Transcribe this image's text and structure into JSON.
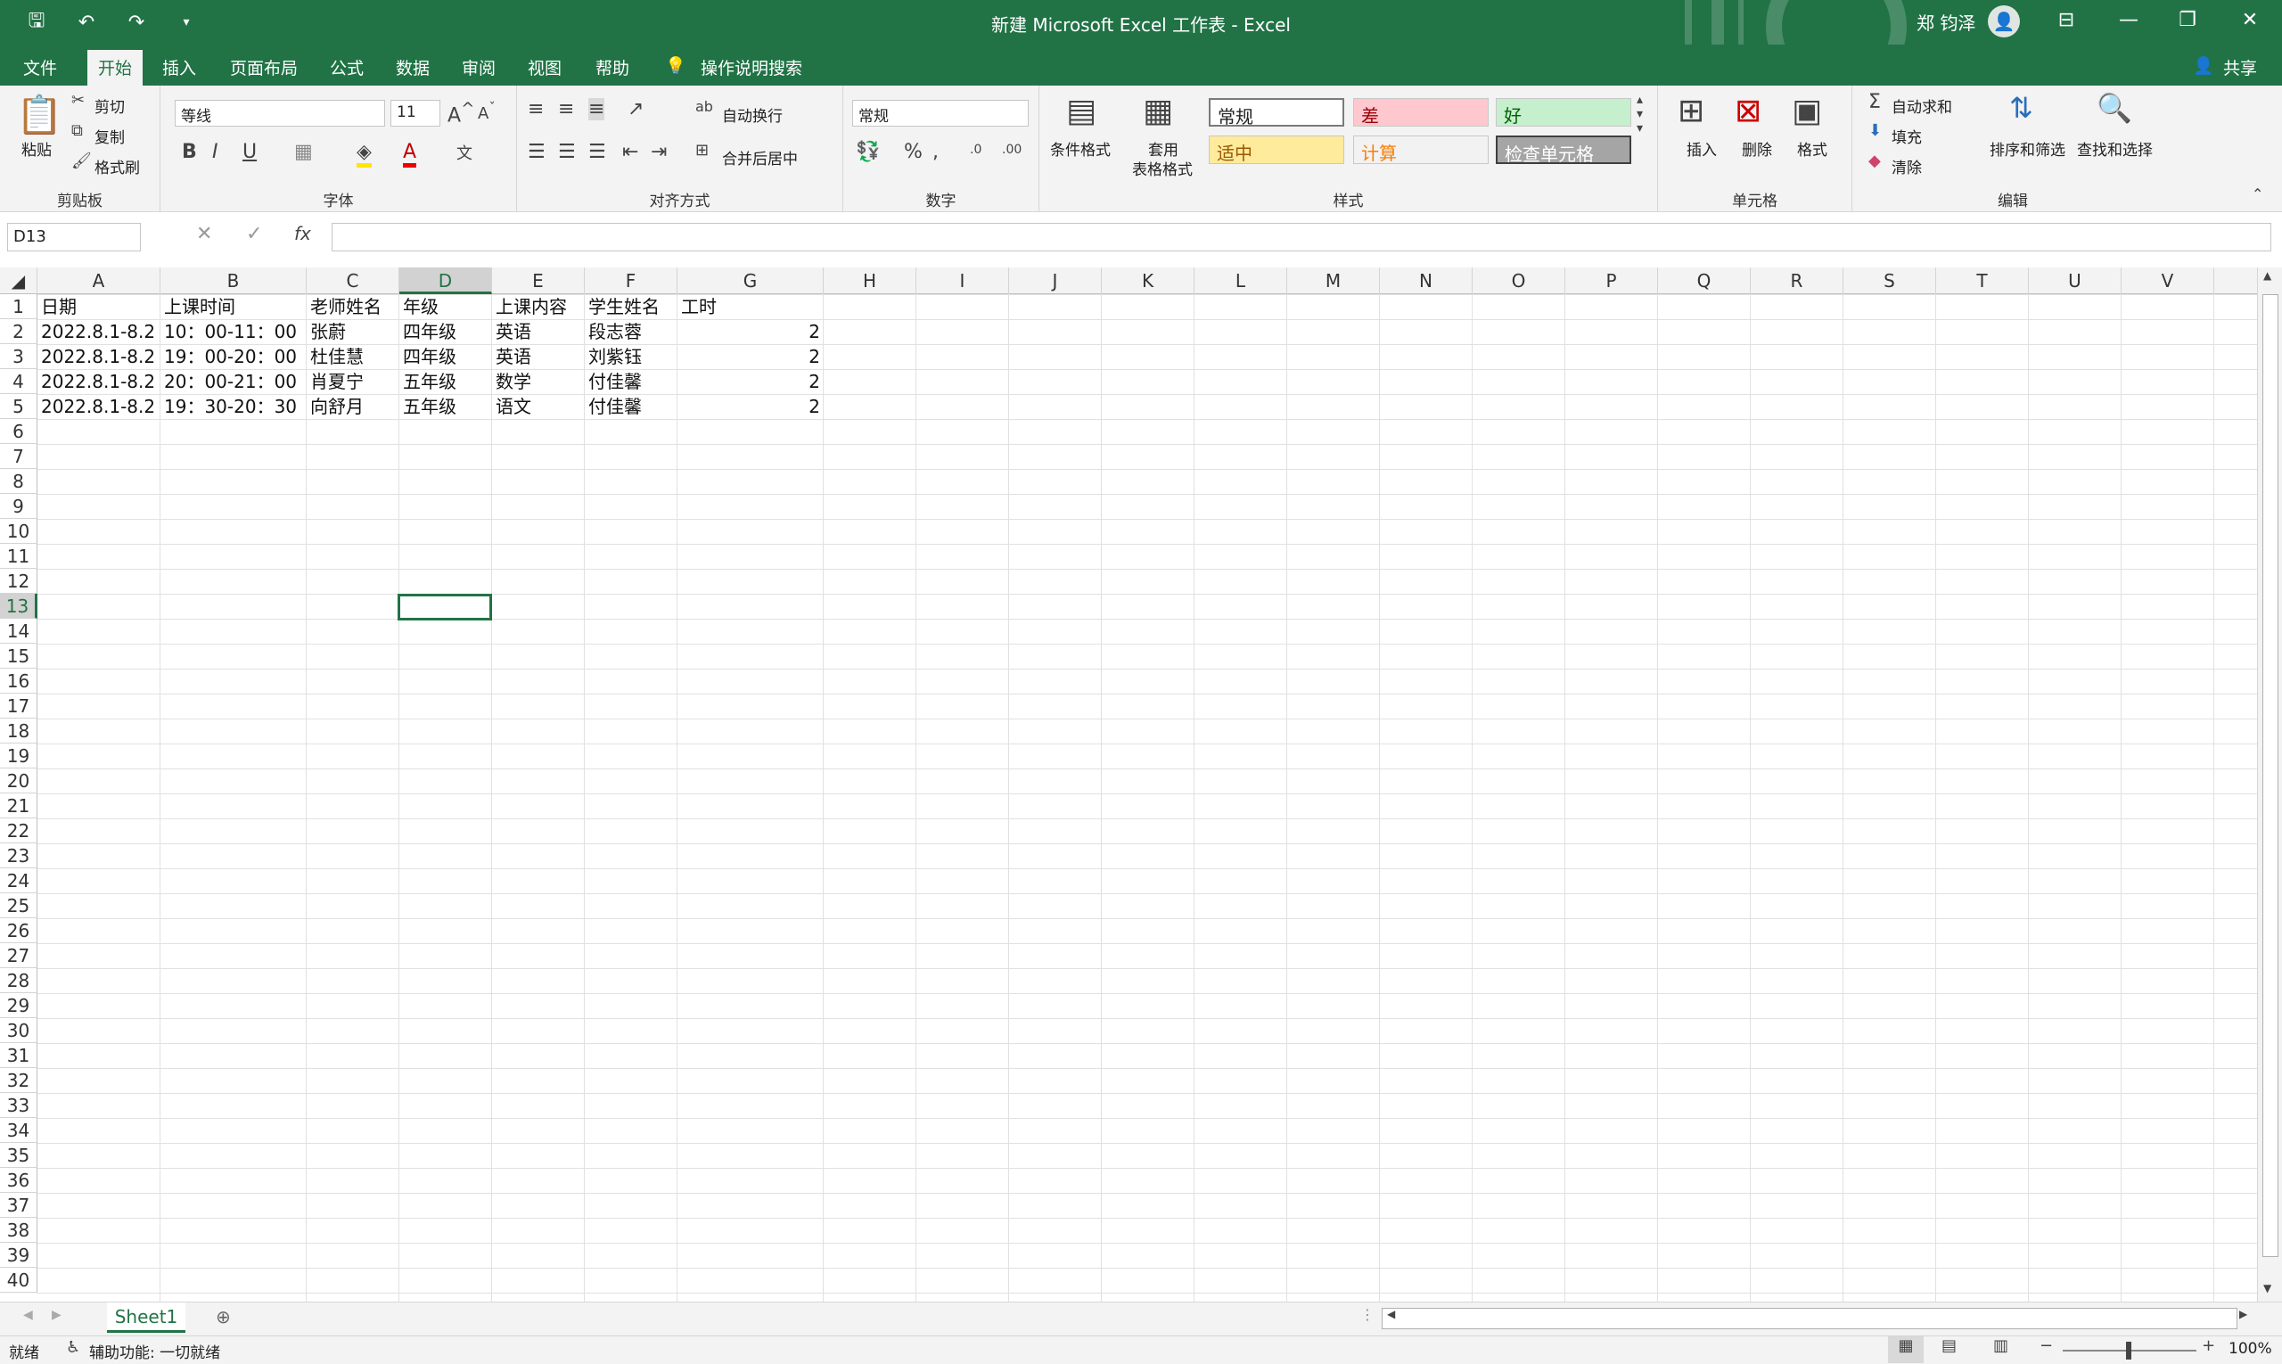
{
  "titlebar": {
    "title": "新建 Microsoft Excel 工作表  -  Excel",
    "user": "郑 钧泽",
    "qat_icons": [
      "save-icon",
      "undo-icon",
      "redo-icon",
      "customize-icon"
    ]
  },
  "menu": {
    "tabs": [
      "文件",
      "开始",
      "插入",
      "页面布局",
      "公式",
      "数据",
      "审阅",
      "视图",
      "帮助"
    ],
    "active": "开始",
    "search": "操作说明搜索",
    "share": "共享"
  },
  "ribbon": {
    "clipboard": {
      "label": "剪贴板",
      "paste": "粘贴",
      "cut": "剪切",
      "copy": "复制",
      "painter": "格式刷"
    },
    "font": {
      "label": "字体",
      "name": "等线",
      "size": "11"
    },
    "alignment": {
      "label": "对齐方式",
      "wrap": "自动换行",
      "merge": "合并后居中"
    },
    "number": {
      "label": "数字",
      "format": "常规"
    },
    "styles": {
      "label": "样式",
      "conditional": "条件格式",
      "table_1": "套用",
      "table_2": "表格格式",
      "normal": "常规",
      "bad": "差",
      "good": "好",
      "neutral": "适中",
      "calc": "计算",
      "check": "检查单元格"
    },
    "cells": {
      "label": "单元格",
      "insert": "插入",
      "delete": "删除",
      "format": "格式"
    },
    "editing": {
      "label": "编辑",
      "autosum": "自动求和",
      "fill": "填充",
      "clear": "清除",
      "sort": "排序和筛选",
      "find": "查找和选择"
    }
  },
  "formula_bar": {
    "name_box": "D13",
    "fx": "fx",
    "value": ""
  },
  "sheet": {
    "columns": [
      "A",
      "B",
      "C",
      "D",
      "E",
      "F",
      "G",
      "H",
      "I",
      "J",
      "K",
      "L",
      "M",
      "N",
      "O",
      "P",
      "Q",
      "R",
      "S",
      "T",
      "U",
      "V"
    ],
    "selected_column": "D",
    "selected_row": 13,
    "row_count": 40,
    "rows": [
      [
        "日期",
        "上课时间",
        "老师姓名",
        "年级",
        "上课内容",
        "学生姓名",
        "工时"
      ],
      [
        "2022.8.1-8.2",
        "10：00-11：00",
        "张蔚",
        "四年级",
        "英语",
        "段志蓉",
        "2"
      ],
      [
        "2022.8.1-8.2",
        "19：00-20：00",
        "杜佳慧",
        "四年级",
        "英语",
        "刘紫钰",
        "2"
      ],
      [
        "2022.8.1-8.2",
        "20：00-21：00",
        "肖夏宁",
        "五年级",
        "数学",
        "付佳馨",
        "2"
      ],
      [
        "2022.8.1-8.2",
        "19：30-20：30",
        "向舒月",
        "五年级",
        "语文",
        "付佳馨",
        "2"
      ]
    ]
  },
  "tabs": {
    "sheet": "Sheet1"
  },
  "status": {
    "ready": "就绪",
    "accessibility": "辅助功能: 一切就绪",
    "zoom": "100%"
  },
  "colors": {
    "accent": "#217346",
    "bad_bg": "#ffc7ce",
    "bad_fg": "#9c0006",
    "good_bg": "#c6efce",
    "good_fg": "#006100",
    "neutral_bg": "#ffeb9c",
    "neutral_fg": "#9c5700",
    "calc_fg": "#fa7d00",
    "check_bg": "#a5a5a5"
  }
}
